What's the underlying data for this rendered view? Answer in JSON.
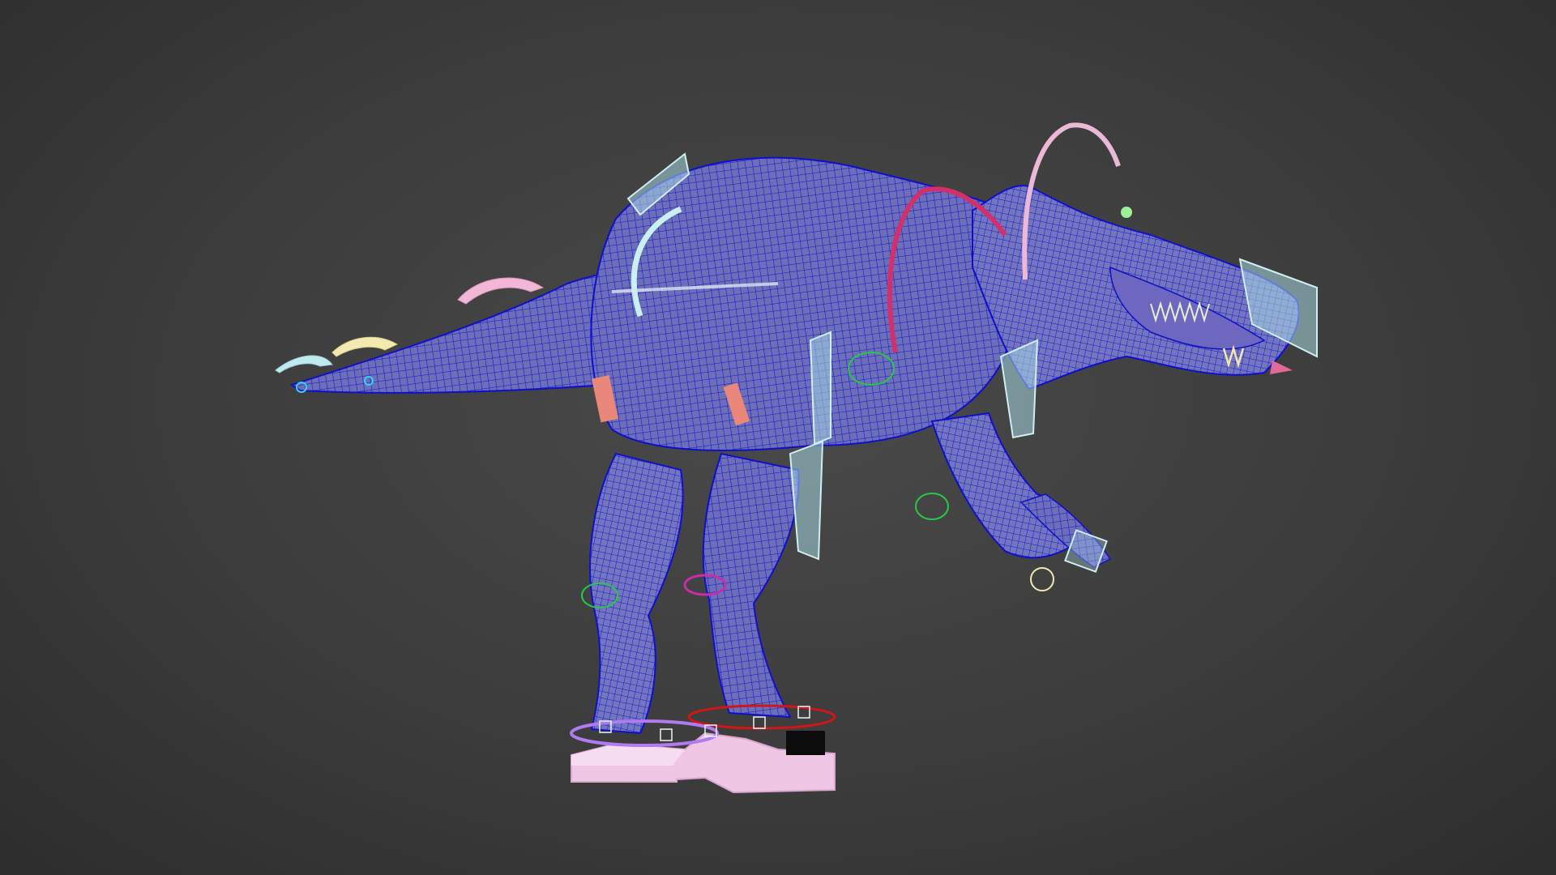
{
  "viewport": {
    "background_color": "#3c3c3c",
    "render_mode": "wireframe",
    "wire_color": "#1a1ad6",
    "mesh_fill_color": "#6d6fb8"
  },
  "model": {
    "subject": "dinosaur-rig",
    "rig_colors": {
      "spine_arc": "#e8b6d6",
      "neck_arc": "#d2306a",
      "hip_arc": "#c8f0f4",
      "tail_controls": [
        "#bfeaf2",
        "#f2eab0",
        "#f2b6d6"
      ],
      "panels": "#a8d8e0",
      "foot_platform": "#f0c8e6",
      "ik_ring_red": "#d01616",
      "ik_ring_purple": "#b07af0",
      "ik_ring_green": "#26c848",
      "leg_ring_magenta": "#c82ea8",
      "hip_block": "#e8877a"
    }
  }
}
